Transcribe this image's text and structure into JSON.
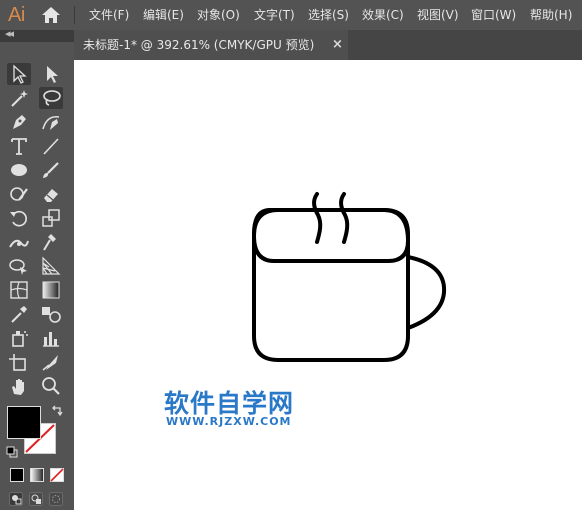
{
  "app": {
    "logo_text": "Ai"
  },
  "menu": [
    {
      "label": "文件(F)"
    },
    {
      "label": "编辑(E)"
    },
    {
      "label": "对象(O)"
    },
    {
      "label": "文字(T)"
    },
    {
      "label": "选择(S)"
    },
    {
      "label": "效果(C)"
    },
    {
      "label": "视图(V)"
    },
    {
      "label": "窗口(W)"
    },
    {
      "label": "帮助(H)"
    }
  ],
  "document_tab": {
    "title": "未标题-1* @ 392.61% (CMYK/GPU 预览)",
    "close": "×"
  },
  "toolbar": {
    "collapse": "◂◂",
    "tools": [
      "selection-tool",
      "direct-selection-tool",
      "magic-wand-tool",
      "lasso-tool",
      "pen-tool",
      "curvature-tool",
      "type-tool",
      "line-segment-tool",
      "ellipse-tool",
      "paintbrush-tool",
      "shaper-tool",
      "eraser-tool",
      "rotate-tool",
      "scale-tool",
      "width-tool",
      "puppet-warp-tool",
      "shape-builder-tool",
      "perspective-grid-tool",
      "mesh-tool",
      "gradient-tool",
      "eyedropper-tool",
      "blend-tool",
      "symbol-sprayer-tool",
      "column-graph-tool",
      "artboard-tool",
      "slice-tool",
      "hand-tool",
      "zoom-tool"
    ]
  },
  "colors": {
    "fill": "#000000",
    "stroke": "none",
    "accent": "#d88a4a",
    "watermark": "#2a78c8"
  },
  "watermark": {
    "title": "软件自学网",
    "url": "WWW.RJZXW.COM"
  }
}
